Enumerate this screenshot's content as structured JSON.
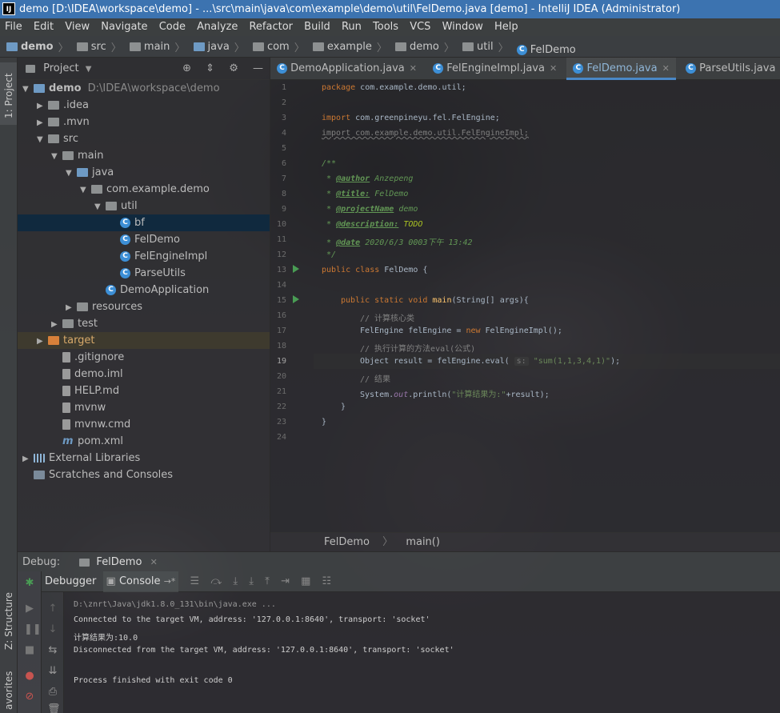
{
  "window": {
    "title": "demo [D:\\IDEA\\workspace\\demo] - ...\\src\\main\\java\\com\\example\\demo\\util\\FelDemo.java [demo] - IntelliJ IDEA (Administrator)",
    "app_icon_text": "IJ"
  },
  "menu": [
    "File",
    "Edit",
    "View",
    "Navigate",
    "Code",
    "Analyze",
    "Refactor",
    "Build",
    "Run",
    "Tools",
    "VCS",
    "Window",
    "Help"
  ],
  "breadcrumb": [
    "demo",
    "src",
    "main",
    "java",
    "com",
    "example",
    "demo",
    "util",
    "FelDemo"
  ],
  "left_stripe": {
    "project_tab": "1: Project",
    "structure_tab": "Z: Structure",
    "favorites_tab": "avorites"
  },
  "project_panel": {
    "title": "Project",
    "tree": [
      {
        "label": "demo",
        "path": "D:\\IDEA\\workspace\\demo",
        "indent": 0,
        "arrow": "▼",
        "icon": "folder-module"
      },
      {
        "label": ".idea",
        "indent": 1,
        "arrow": "▶",
        "icon": "folder"
      },
      {
        "label": ".mvn",
        "indent": 1,
        "arrow": "▶",
        "icon": "folder"
      },
      {
        "label": "src",
        "indent": 1,
        "arrow": "▼",
        "icon": "folder"
      },
      {
        "label": "main",
        "indent": 2,
        "arrow": "▼",
        "icon": "folder"
      },
      {
        "label": "java",
        "indent": 3,
        "arrow": "▼",
        "icon": "folder-source"
      },
      {
        "label": "com.example.demo",
        "indent": 4,
        "arrow": "▼",
        "icon": "package"
      },
      {
        "label": "util",
        "indent": 5,
        "arrow": "▼",
        "icon": "package"
      },
      {
        "label": "bf",
        "indent": 6,
        "arrow": "",
        "icon": "class",
        "selected": true
      },
      {
        "label": "FelDemo",
        "indent": 6,
        "arrow": "",
        "icon": "class"
      },
      {
        "label": "FelEngineImpl",
        "indent": 6,
        "arrow": "",
        "icon": "class"
      },
      {
        "label": "ParseUtils",
        "indent": 6,
        "arrow": "",
        "icon": "class"
      },
      {
        "label": "DemoApplication",
        "indent": 5,
        "arrow": "",
        "icon": "spring-class"
      },
      {
        "label": "resources",
        "indent": 3,
        "arrow": "▶",
        "icon": "folder-resources"
      },
      {
        "label": "test",
        "indent": 2,
        "arrow": "▶",
        "icon": "folder"
      },
      {
        "label": "target",
        "indent": 1,
        "arrow": "▶",
        "icon": "folder-excluded",
        "highlight": true
      },
      {
        "label": ".gitignore",
        "indent": 2,
        "arrow": "",
        "icon": "file"
      },
      {
        "label": "demo.iml",
        "indent": 2,
        "arrow": "",
        "icon": "file"
      },
      {
        "label": "HELP.md",
        "indent": 2,
        "arrow": "",
        "icon": "markdown-file"
      },
      {
        "label": "mvnw",
        "indent": 2,
        "arrow": "",
        "icon": "file"
      },
      {
        "label": "mvnw.cmd",
        "indent": 2,
        "arrow": "",
        "icon": "file"
      },
      {
        "label": "pom.xml",
        "indent": 2,
        "arrow": "",
        "icon": "maven-file"
      },
      {
        "label": "External Libraries",
        "indent": 0,
        "arrow": "▶",
        "icon": "libraries"
      },
      {
        "label": "Scratches and Consoles",
        "indent": 0,
        "arrow": "",
        "icon": "scratches"
      }
    ]
  },
  "tabs": [
    {
      "label": "DemoApplication.java",
      "active": false
    },
    {
      "label": "FelEngineImpl.java",
      "active": false
    },
    {
      "label": "FelDemo.java",
      "active": true
    },
    {
      "label": "ParseUtils.java",
      "active": false
    }
  ],
  "editor": {
    "line_numbers": [
      "1",
      "2",
      "3",
      "4",
      "5",
      "6",
      "7",
      "8",
      "9",
      "10",
      "11",
      "12",
      "13",
      "14",
      "15",
      "16",
      "17",
      "18",
      "19",
      "20",
      "21",
      "22",
      "23",
      "24"
    ],
    "current_line": 19,
    "code": {
      "l1_kw": "package",
      "l1_rest": " com.example.demo.util;",
      "l3_kw": "import",
      "l3_rest": " com.greenpineyu.fel.FelEngine;",
      "l4": "import com.example.demo.util.FelEngineImpl;",
      "l6": "/**",
      "l7_tag": "@author",
      "l7_val": " Anzepeng",
      "l8_tag": "@title:",
      "l8_val": " FelDemo",
      "l9_tag": "@projectName",
      "l9_val": " demo",
      "l10_tag": "@description:",
      "l10_val": " TODO",
      "l11_tag": "@date",
      "l11_val": " 2020/6/3 0003下午 13:42",
      "l12": " */",
      "l14_kw": "public class",
      "l14_rest": " FelDemo {",
      "l16_kw": "public static void",
      "l16_fn": " main",
      "l16_rest": "(String[] args){",
      "l17": "// 计算核心类",
      "l18_a": "FelEngine felEngine = ",
      "l18_kw": "new",
      "l18_b": " FelEngineImpl();",
      "l19_c": "// 执行计算的方法eval(公式)",
      "l20_a": "Object result = felEngine.eval( ",
      "l20_hint": "s:",
      "l20_str": " \"sum(1,1,3,4,1)\"",
      "l20_b": ");",
      "l21": "// 结果",
      "l22_a": "System.",
      "l22_fld": "out",
      "l22_b": ".println(",
      "l22_str": "\"计算结果为:\"",
      "l22_c": "+result);",
      "l23": "}",
      "l24": "}"
    }
  },
  "editor_breadcrumb": [
    "FelDemo",
    "main()"
  ],
  "debug": {
    "label": "Debug:",
    "session": "FelDemo",
    "tabs": [
      "Debugger",
      "Console"
    ],
    "console": [
      "D:\\znrt\\Java\\jdk1.8.0_131\\bin\\java.exe ...",
      "Connected to the target VM, address: '127.0.0.1:8640', transport: 'socket'",
      "计算结果为:10.0",
      "Disconnected from the target VM, address: '127.0.0.1:8640', transport: 'socket'",
      "",
      "Process finished with exit code 0"
    ]
  },
  "colors": {
    "accent": "#4a88c7",
    "keyword": "#cc7832",
    "comment": "#629755",
    "string": "#6a8759"
  }
}
